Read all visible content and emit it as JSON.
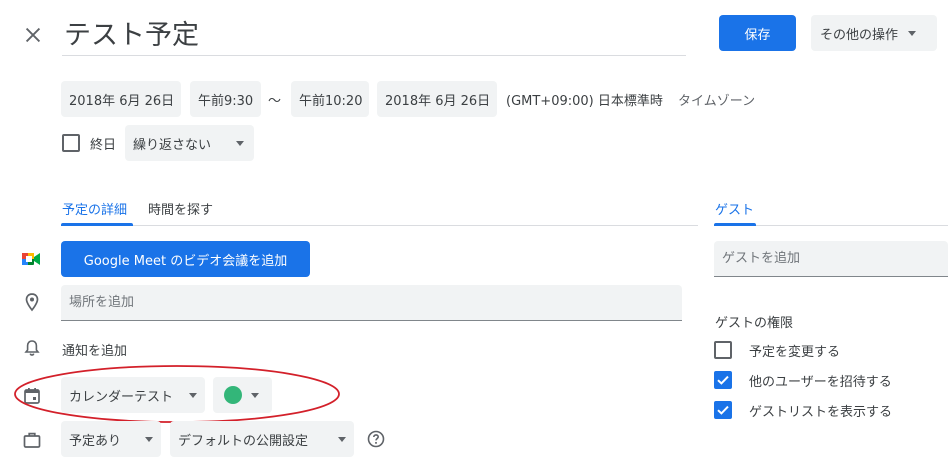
{
  "header": {
    "title_value": "テスト予定",
    "save_label": "保存",
    "more_actions_label": "その他の操作"
  },
  "datetime": {
    "start_date": "2018年 6月 26日",
    "start_time": "午前9:30",
    "separator": "〜",
    "end_time": "午前10:20",
    "end_date": "2018年 6月 26日",
    "timezone_value": "(GMT+09:00) 日本標準時",
    "timezone_link": "タイムゾーン"
  },
  "options": {
    "all_day_label": "終日",
    "recurrence_value": "繰り返さない"
  },
  "tabs": {
    "details": "予定の詳細",
    "find_time": "時間を探す",
    "guests": "ゲスト"
  },
  "details": {
    "meet_button": "Google Meet のビデオ会議を追加",
    "location_placeholder": "場所を追加",
    "notification_link": "通知を追加",
    "calendar_value": "カレンダーテスト",
    "event_color": "#33b679",
    "availability_value": "予定あり",
    "visibility_value": "デフォルトの公開設定"
  },
  "guests": {
    "add_placeholder": "ゲストを追加",
    "permissions_heading": "ゲストの権限",
    "permissions": [
      {
        "label": "予定を変更する",
        "checked": false
      },
      {
        "label": "他のユーザーを招待する",
        "checked": true
      },
      {
        "label": "ゲストリストを表示する",
        "checked": true
      }
    ]
  },
  "colors": {
    "accent": "#1a73e8",
    "annotation": "#d3202a"
  }
}
